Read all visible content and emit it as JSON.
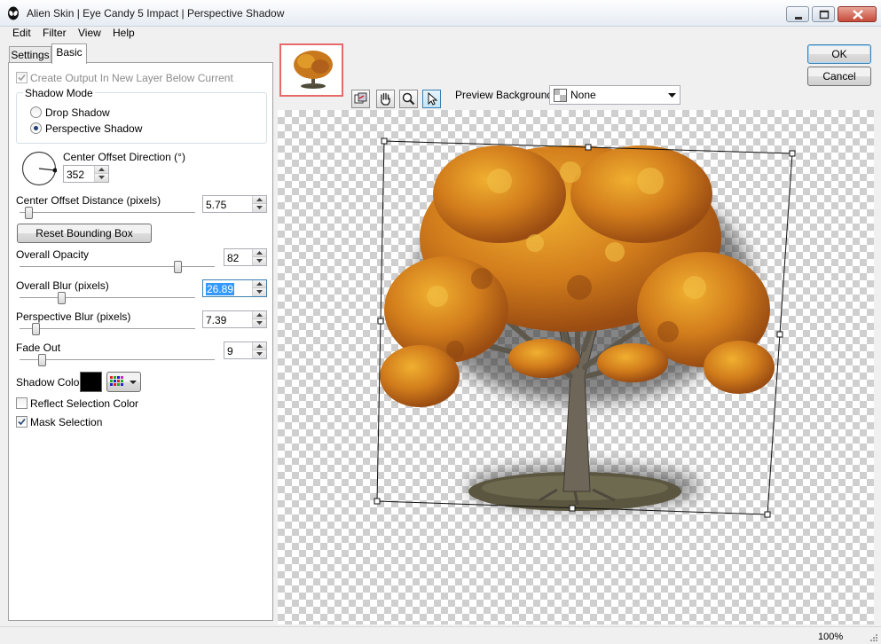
{
  "window": {
    "title": "Alien Skin | Eye Candy 5 Impact | Perspective Shadow",
    "icon": "alien-skin-icon",
    "controls": [
      "minimize-icon",
      "maximize-icon",
      "close-icon"
    ]
  },
  "menu": {
    "items": [
      "Edit",
      "Filter",
      "View",
      "Help"
    ]
  },
  "tabs": {
    "settings": "Settings",
    "basic": "Basic"
  },
  "basic": {
    "create_output_label": "Create Output In New Layer Below Current",
    "create_output_checked": true,
    "shadow_mode": {
      "title": "Shadow Mode",
      "options": [
        "Drop Shadow",
        "Perspective Shadow"
      ],
      "selected": "Perspective Shadow"
    },
    "center_offset_direction": {
      "label": "Center Offset Direction (°)",
      "value": "352"
    },
    "center_offset_distance": {
      "label": "Center Offset Distance (pixels)",
      "value": "5.75",
      "slider_fraction": 0.06
    },
    "reset_button": "Reset Bounding Box",
    "overall_opacity": {
      "label": "Overall Opacity",
      "value": "82",
      "slider_fraction": 0.82
    },
    "overall_blur": {
      "label": "Overall Blur (pixels)",
      "value": "26.89",
      "slider_fraction": 0.25
    },
    "perspective_blur": {
      "label": "Perspective Blur (pixels)",
      "value": "7.39",
      "slider_fraction": 0.08
    },
    "fade_out": {
      "label": "Fade Out",
      "value": "9",
      "slider_fraction": 0.09
    },
    "shadow_color": {
      "label": "Shadow Color",
      "value": "#000000"
    },
    "reflect_selection_color": {
      "label": "Reflect Selection Color",
      "checked": false
    },
    "mask_selection": {
      "label": "Mask Selection",
      "checked": true
    }
  },
  "buttons": {
    "ok": "OK",
    "cancel": "Cancel"
  },
  "toolbar": {
    "tools": [
      "preview-toggle-icon",
      "hand-icon",
      "zoom-icon",
      "pointer-icon"
    ],
    "active_tool": "pointer-icon",
    "preview_background_label": "Preview Background:",
    "preview_background_value": "None"
  },
  "status": {
    "zoom": "100%"
  },
  "colors": {
    "foliage": "#c8781c",
    "thumbnail_border": "#e8696b",
    "accent": "#3399ff"
  }
}
